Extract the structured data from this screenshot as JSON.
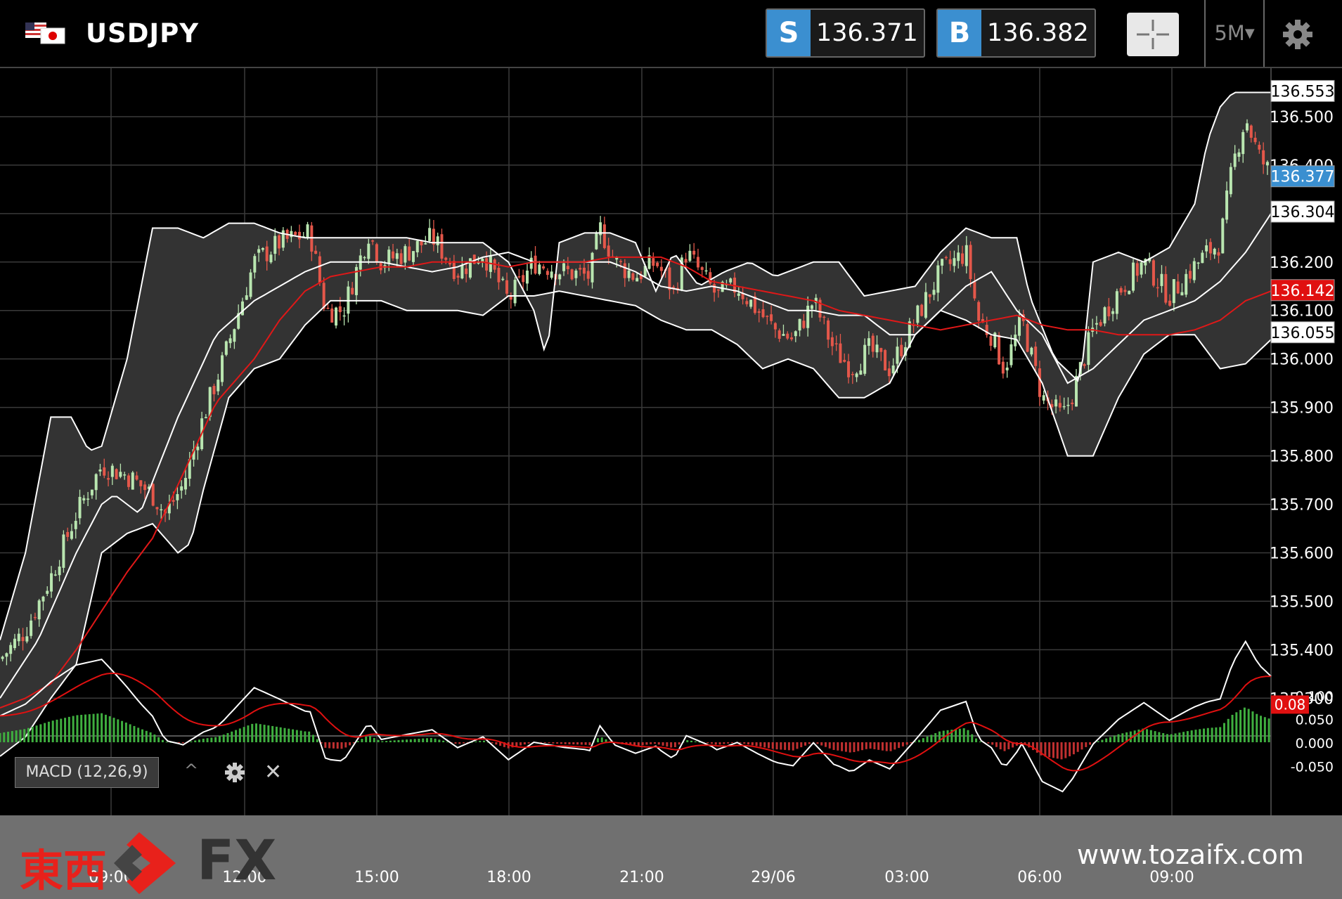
{
  "header": {
    "symbol": "USDJPY",
    "sell_label": "S",
    "sell_price": "136.371",
    "buy_label": "B",
    "buy_price": "136.382",
    "timeframe": "5M",
    "icons": [
      "us-japan-flag-icon",
      "crosshair-icon",
      "chevron-down-icon",
      "gear-icon"
    ]
  },
  "macd": {
    "label": "MACD (12,26,9)",
    "current_value": "0.08",
    "y_ticks": [
      "0.100",
      "0.050",
      "0.000",
      "-0.050"
    ],
    "colors": {
      "macd_line": "#ffffff",
      "signal_line": "#e01010",
      "histogram_pos": "#3fae3f",
      "histogram_neg": "#c03030"
    }
  },
  "brand": {
    "logo_text_kanji": "東西",
    "logo_text_fx": "FX",
    "website": "www.tozaifx.com"
  },
  "colors": {
    "up_candle": "#b9e6b0",
    "down_candle": "#e4574a",
    "band_fill": "#333333",
    "ma_red": "#e01818",
    "price_tag_blue": "#3a8fd0",
    "price_tag_red": "#e01010"
  },
  "chart_data": {
    "type": "candlestick",
    "symbol": "USDJPY",
    "timeframe": "5M",
    "indicators": [
      "Bollinger Bands",
      "Moving Average",
      "MACD (12,26,9)"
    ],
    "y_ticks": [
      "135.300",
      "135.400",
      "135.500",
      "135.600",
      "135.700",
      "135.800",
      "135.900",
      "136.000",
      "136.100",
      "136.200",
      "136.300",
      "136.400",
      "136.500"
    ],
    "ylim": [
      135.225,
      136.6
    ],
    "x_ticks": [
      "09:00",
      "12:00",
      "15:00",
      "18:00",
      "21:00",
      "29/06",
      "03:00",
      "06:00",
      "09:00"
    ],
    "price_tags": [
      {
        "value": "136.553",
        "role": "upper band"
      },
      {
        "value": "136.377",
        "role": "current price"
      },
      {
        "value": "136.304",
        "role": "middle band"
      },
      {
        "value": "136.142",
        "role": "moving average"
      },
      {
        "value": "136.055",
        "role": "lower band"
      }
    ],
    "close_path": [
      [
        0,
        135.38
      ],
      [
        10,
        135.44
      ],
      [
        20,
        135.55
      ],
      [
        30,
        135.68
      ],
      [
        40,
        135.78
      ],
      [
        50,
        135.76
      ],
      [
        60,
        135.72
      ],
      [
        65,
        135.68
      ],
      [
        72,
        135.74
      ],
      [
        80,
        135.88
      ],
      [
        88,
        136.0
      ],
      [
        100,
        136.2
      ],
      [
        110,
        136.24
      ],
      [
        122,
        136.26
      ],
      [
        128,
        136.1
      ],
      [
        135,
        136.1
      ],
      [
        145,
        136.26
      ],
      [
        150,
        136.2
      ],
      [
        160,
        136.22
      ],
      [
        170,
        136.25
      ],
      [
        180,
        136.18
      ],
      [
        190,
        136.22
      ],
      [
        200,
        136.12
      ],
      [
        210,
        136.2
      ],
      [
        222,
        136.18
      ],
      [
        232,
        136.17
      ],
      [
        236,
        136.27
      ],
      [
        242,
        136.2
      ],
      [
        250,
        136.17
      ],
      [
        258,
        136.2
      ],
      [
        265,
        136.14
      ],
      [
        270,
        136.22
      ],
      [
        282,
        136.13
      ],
      [
        290,
        136.15
      ],
      [
        298,
        136.1
      ],
      [
        305,
        136.06
      ],
      [
        312,
        136.04
      ],
      [
        320,
        136.12
      ],
      [
        328,
        136.02
      ],
      [
        335,
        135.98
      ],
      [
        342,
        136.02
      ],
      [
        350,
        135.98
      ],
      [
        360,
        136.08
      ],
      [
        370,
        136.18
      ],
      [
        380,
        136.22
      ],
      [
        385,
        136.08
      ],
      [
        390,
        136.05
      ],
      [
        395,
        135.98
      ],
      [
        402,
        136.08
      ],
      [
        410,
        135.92
      ],
      [
        418,
        135.88
      ],
      [
        422,
        135.93
      ],
      [
        430,
        136.06
      ],
      [
        440,
        136.14
      ],
      [
        450,
        136.2
      ],
      [
        460,
        136.13
      ],
      [
        468,
        136.18
      ],
      [
        475,
        136.22
      ],
      [
        480,
        136.24
      ],
      [
        485,
        136.4
      ],
      [
        490,
        136.5
      ],
      [
        495,
        136.42
      ],
      [
        500,
        136.38
      ]
    ],
    "bollinger_upper": [
      [
        0,
        135.42
      ],
      [
        10,
        135.6
      ],
      [
        20,
        135.88
      ],
      [
        28,
        135.88
      ],
      [
        35,
        135.81
      ],
      [
        40,
        135.82
      ],
      [
        50,
        136.0
      ],
      [
        60,
        136.27
      ],
      [
        70,
        136.27
      ],
      [
        80,
        136.25
      ],
      [
        90,
        136.28
      ],
      [
        100,
        136.28
      ],
      [
        110,
        136.26
      ],
      [
        120,
        136.25
      ],
      [
        130,
        136.25
      ],
      [
        140,
        136.25
      ],
      [
        150,
        136.25
      ],
      [
        160,
        136.25
      ],
      [
        170,
        136.24
      ],
      [
        180,
        136.24
      ],
      [
        190,
        136.24
      ],
      [
        200,
        136.2
      ],
      [
        210,
        136.1
      ],
      [
        215,
        136.0
      ],
      [
        220,
        136.24
      ],
      [
        230,
        136.26
      ],
      [
        240,
        136.26
      ],
      [
        250,
        136.24
      ],
      [
        258,
        136.14
      ],
      [
        265,
        136.22
      ],
      [
        275,
        136.15
      ],
      [
        285,
        136.18
      ],
      [
        295,
        136.2
      ],
      [
        305,
        136.17
      ],
      [
        320,
        136.2
      ],
      [
        330,
        136.2
      ],
      [
        340,
        136.13
      ],
      [
        350,
        136.14
      ],
      [
        360,
        136.15
      ],
      [
        370,
        136.22
      ],
      [
        380,
        136.27
      ],
      [
        390,
        136.25
      ],
      [
        400,
        136.25
      ],
      [
        405,
        136.13
      ],
      [
        415,
        136.0
      ],
      [
        425,
        135.95
      ],
      [
        430,
        136.2
      ],
      [
        440,
        136.22
      ],
      [
        450,
        136.2
      ],
      [
        460,
        136.23
      ],
      [
        470,
        136.32
      ],
      [
        475,
        136.45
      ],
      [
        480,
        136.52
      ],
      [
        485,
        136.55
      ],
      [
        500,
        136.55
      ]
    ],
    "bollinger_middle": [
      [
        0,
        135.3
      ],
      [
        15,
        135.42
      ],
      [
        30,
        135.6
      ],
      [
        40,
        135.7
      ],
      [
        45,
        135.72
      ],
      [
        55,
        135.68
      ],
      [
        70,
        135.88
      ],
      [
        85,
        136.05
      ],
      [
        100,
        136.12
      ],
      [
        110,
        136.15
      ],
      [
        120,
        136.18
      ],
      [
        130,
        136.2
      ],
      [
        140,
        136.2
      ],
      [
        150,
        136.2
      ],
      [
        160,
        136.19
      ],
      [
        170,
        136.18
      ],
      [
        180,
        136.19
      ],
      [
        190,
        136.21
      ],
      [
        200,
        136.22
      ],
      [
        210,
        136.2
      ],
      [
        220,
        136.2
      ],
      [
        240,
        136.2
      ],
      [
        250,
        136.18
      ],
      [
        260,
        136.15
      ],
      [
        270,
        136.14
      ],
      [
        280,
        136.15
      ],
      [
        290,
        136.14
      ],
      [
        300,
        136.12
      ],
      [
        310,
        136.1
      ],
      [
        320,
        136.1
      ],
      [
        330,
        136.09
      ],
      [
        340,
        136.09
      ],
      [
        350,
        136.05
      ],
      [
        360,
        136.05
      ],
      [
        370,
        136.1
      ],
      [
        380,
        136.15
      ],
      [
        390,
        136.18
      ],
      [
        400,
        136.1
      ],
      [
        410,
        136.05
      ],
      [
        420,
        135.95
      ],
      [
        430,
        135.98
      ],
      [
        440,
        136.03
      ],
      [
        450,
        136.08
      ],
      [
        460,
        136.1
      ],
      [
        470,
        136.12
      ],
      [
        480,
        136.16
      ],
      [
        490,
        136.22
      ],
      [
        500,
        136.3
      ]
    ],
    "bollinger_lower": [
      [
        0,
        135.18
      ],
      [
        10,
        135.22
      ],
      [
        20,
        135.3
      ],
      [
        30,
        135.37
      ],
      [
        40,
        135.6
      ],
      [
        50,
        135.64
      ],
      [
        60,
        135.66
      ],
      [
        70,
        135.6
      ],
      [
        75,
        135.62
      ],
      [
        80,
        135.73
      ],
      [
        90,
        135.92
      ],
      [
        100,
        135.98
      ],
      [
        110,
        136.0
      ],
      [
        120,
        136.07
      ],
      [
        130,
        136.12
      ],
      [
        140,
        136.12
      ],
      [
        150,
        136.12
      ],
      [
        160,
        136.1
      ],
      [
        170,
        136.1
      ],
      [
        180,
        136.1
      ],
      [
        190,
        136.09
      ],
      [
        200,
        136.13
      ],
      [
        210,
        136.13
      ],
      [
        220,
        136.14
      ],
      [
        230,
        136.13
      ],
      [
        240,
        136.12
      ],
      [
        250,
        136.11
      ],
      [
        260,
        136.08
      ],
      [
        270,
        136.06
      ],
      [
        280,
        136.06
      ],
      [
        290,
        136.03
      ],
      [
        300,
        135.98
      ],
      [
        310,
        136.0
      ],
      [
        320,
        135.98
      ],
      [
        330,
        135.92
      ],
      [
        340,
        135.92
      ],
      [
        350,
        135.95
      ],
      [
        360,
        136.05
      ],
      [
        370,
        136.1
      ],
      [
        380,
        136.08
      ],
      [
        390,
        136.05
      ],
      [
        400,
        136.04
      ],
      [
        410,
        135.95
      ],
      [
        420,
        135.8
      ],
      [
        430,
        135.8
      ],
      [
        440,
        135.92
      ],
      [
        450,
        136.01
      ],
      [
        460,
        136.05
      ],
      [
        470,
        136.05
      ],
      [
        480,
        135.98
      ],
      [
        490,
        135.99
      ],
      [
        500,
        136.04
      ]
    ],
    "moving_average": [
      [
        0,
        135.28
      ],
      [
        10,
        135.3
      ],
      [
        20,
        135.33
      ],
      [
        30,
        135.4
      ],
      [
        40,
        135.48
      ],
      [
        50,
        135.56
      ],
      [
        60,
        135.63
      ],
      [
        70,
        135.74
      ],
      [
        85,
        135.91
      ],
      [
        100,
        136.0
      ],
      [
        110,
        136.08
      ],
      [
        120,
        136.14
      ],
      [
        130,
        136.17
      ],
      [
        140,
        136.18
      ],
      [
        150,
        136.19
      ],
      [
        160,
        136.19
      ],
      [
        170,
        136.2
      ],
      [
        180,
        136.2
      ],
      [
        190,
        136.2
      ],
      [
        200,
        136.19
      ],
      [
        210,
        136.2
      ],
      [
        220,
        136.2
      ],
      [
        230,
        136.2
      ],
      [
        240,
        136.21
      ],
      [
        250,
        136.21
      ],
      [
        260,
        136.21
      ],
      [
        270,
        136.19
      ],
      [
        280,
        136.16
      ],
      [
        290,
        136.15
      ],
      [
        300,
        136.14
      ],
      [
        310,
        136.13
      ],
      [
        320,
        136.12
      ],
      [
        330,
        136.1
      ],
      [
        340,
        136.09
      ],
      [
        350,
        136.08
      ],
      [
        360,
        136.07
      ],
      [
        370,
        136.06
      ],
      [
        380,
        136.07
      ],
      [
        390,
        136.08
      ],
      [
        400,
        136.09
      ],
      [
        410,
        136.07
      ],
      [
        420,
        136.06
      ],
      [
        430,
        136.06
      ],
      [
        440,
        136.05
      ],
      [
        450,
        136.05
      ],
      [
        460,
        136.05
      ],
      [
        470,
        136.06
      ],
      [
        480,
        136.08
      ],
      [
        490,
        136.12
      ],
      [
        500,
        136.14
      ]
    ]
  }
}
